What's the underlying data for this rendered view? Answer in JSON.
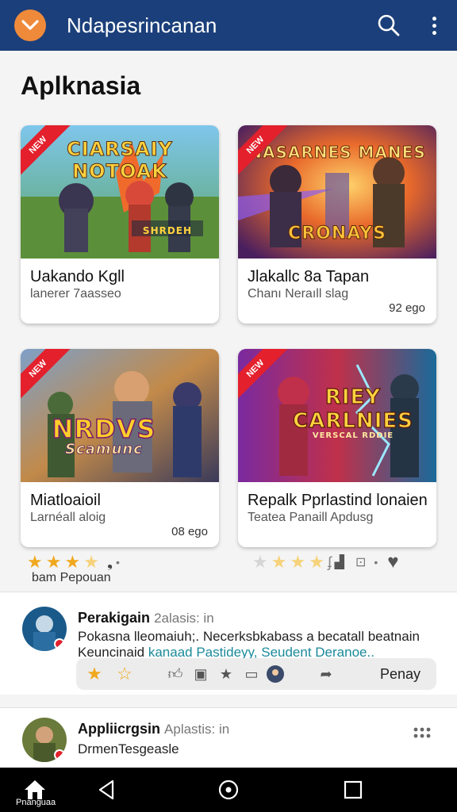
{
  "appbar": {
    "title": "Ndapesrincanan",
    "menu_icon": "chevron-down-icon",
    "search_icon": "search-icon",
    "more_icon": "more-vertical-icon",
    "accent": "#ef8a3b",
    "color": "#1b3f7a"
  },
  "section": {
    "title": "Aplknasia"
  },
  "cards": [
    {
      "art_title": "CIARSAIY NOTOAK",
      "art_sub": "SHRDEH",
      "name": "Uakando Kgll",
      "sub": "lanerer 7aasseo",
      "time": ""
    },
    {
      "art_title": "NASARNES MANES",
      "art_sub": "CRONAYS",
      "name": "Jlakallc 8a Tapan",
      "sub": "Chanı Neraıll slag",
      "time": "92 ego"
    },
    {
      "art_title": "NRDVS",
      "art_sub": "Scamunc",
      "name": "Miatloaioil",
      "sub": "Larnéall aloig",
      "time": "08 ego"
    },
    {
      "art_title": "RIEY CARLNIES",
      "art_sub": "VERSCAL RDDIE",
      "name": "Repalk Pprlastind lonaien",
      "sub": "Teatea Panaill Apdusg",
      "time": ""
    }
  ],
  "rating": {
    "value": 3.5,
    "max": 5,
    "label": "bam Pepouan"
  },
  "posts": [
    {
      "name": "Perakigain",
      "meta": "2alasis: in",
      "line1": "Pokasna lleomaiuh;. Necerksbkabass a becatall beatnain",
      "line2_plain": "Keuncinaid ",
      "line2_link": "kanaad Pastideyy, Seudent Deranoe..",
      "action_label": "Penay"
    },
    {
      "name": "Appliicrgsin",
      "meta": "Aplastis: in",
      "line1": "DrmenTesgeasle"
    }
  ],
  "navbar": {
    "home_label": "Pnanguaa"
  }
}
